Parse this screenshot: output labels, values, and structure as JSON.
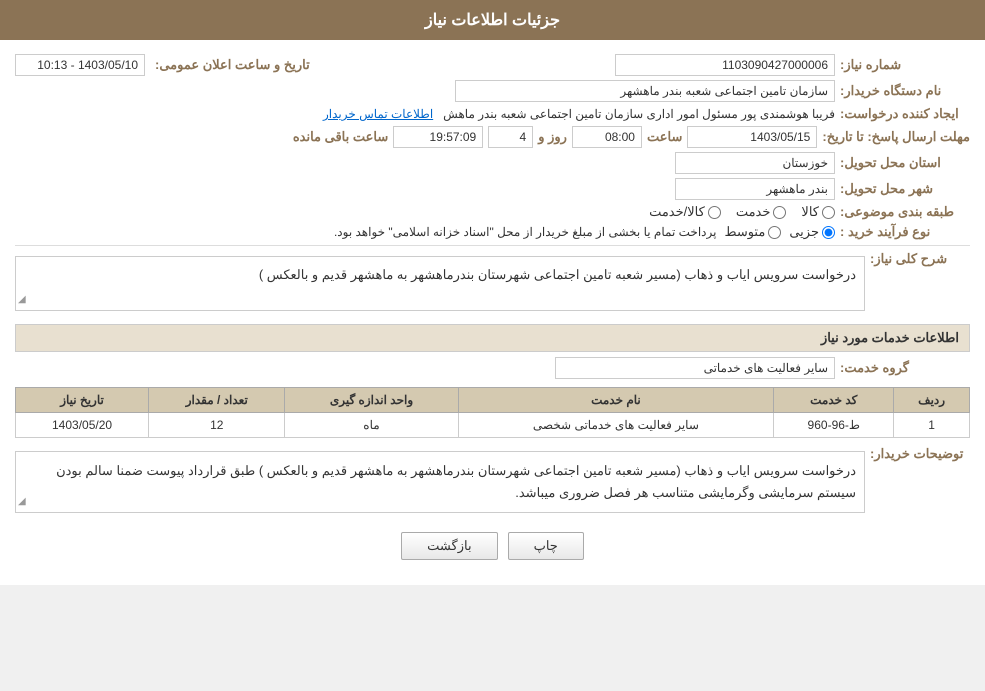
{
  "header": {
    "title": "جزئیات اطلاعات نیاز"
  },
  "fields": {
    "shomareNiaz_label": "شماره نیاز:",
    "shomareNiaz_value": "1103090427000006",
    "namDastgah_label": "نام دستگاه خریدار:",
    "namDastgah_value": "سازمان تامین اجتماعی شعبه بندر ماهشهر",
    "eijadKonande_label": "ایجاد کننده درخواست:",
    "eijadKonande_value": "فریبا هوشمندی پور مسئول امور اداری سازمان تامین اجتماعی شعبه بندر ماهش",
    "eijadKonande_link": "اطلاعات تماس خریدار",
    "mohlatErsalPasokh_label": "مهلت ارسال پاسخ: تا تاریخ:",
    "tarikhPasokh": "1403/05/15",
    "saatPasokh": "08:00",
    "roozPasokh": "4",
    "baghimandeh": "19:57:09",
    "baghimandeh_label": "ساعت باقی مانده",
    "tarikhElanOmomi_label": "تاریخ و ساعت اعلان عمومی:",
    "tarikhElan_value": "1403/05/10 - 10:13",
    "ostan_label": "استان محل تحویل:",
    "ostan_value": "خوزستان",
    "shahr_label": "شهر محل تحویل:",
    "shahr_value": "بندر ماهشهر",
    "tabagheBandi_label": "طبقه بندی موضوعی:",
    "tabaqe_kala": "کالا",
    "tabaqe_khedmat": "خدمت",
    "tabaqe_kala_khedmat": "کالا/خدمت",
    "noeFarayand_label": "نوع فرآیند خرید :",
    "farayand_jozii": "جزیی",
    "farayand_motovaset": "متوسط",
    "farayand_desc": "پرداخت تمام یا بخشی از مبلغ خریدار از محل \"اسناد خزانه اسلامی\" خواهد بود.",
    "sharhKoli_label": "شرح کلی نیاز:",
    "sharhKoli_value": "درخواست سرویس ایاب و ذهاب (مسیر شعبه تامین اجتماعی شهرستان بندرماهشهر به ماهشهر قدیم و بالعکس )",
    "etelaatKhadamat_title": "اطلاعات خدمات مورد نیاز",
    "goreKhadamat_label": "گروه خدمت:",
    "goreKhadamat_value": "سایر فعالیت های خدماتی",
    "table": {
      "headers": [
        "ردیف",
        "کد خدمت",
        "نام خدمت",
        "واحد اندازه گیری",
        "تعداد / مقدار",
        "تاریخ نیاز"
      ],
      "rows": [
        {
          "radif": "1",
          "kod": "ط-96-960",
          "name": "سایر فعالیت های خدماتی شخصی",
          "vahed": "ماه",
          "tedad": "12",
          "tarikh": "1403/05/20"
        }
      ]
    },
    "tozi_label": "توضیحات خریدار:",
    "tozi_value": "درخواست سرویس ایاب و ذهاب (مسیر شعبه تامین اجتماعی شهرستان بندرماهشهر به ماهشهر قدیم و بالعکس ) طبق قرارداد پیوست ضمنا سالم بودن سیستم سرمایشی وگرمایشی متناسب هر فصل ضروری میباشد."
  },
  "buttons": {
    "print": "چاپ",
    "back": "بازگشت"
  }
}
